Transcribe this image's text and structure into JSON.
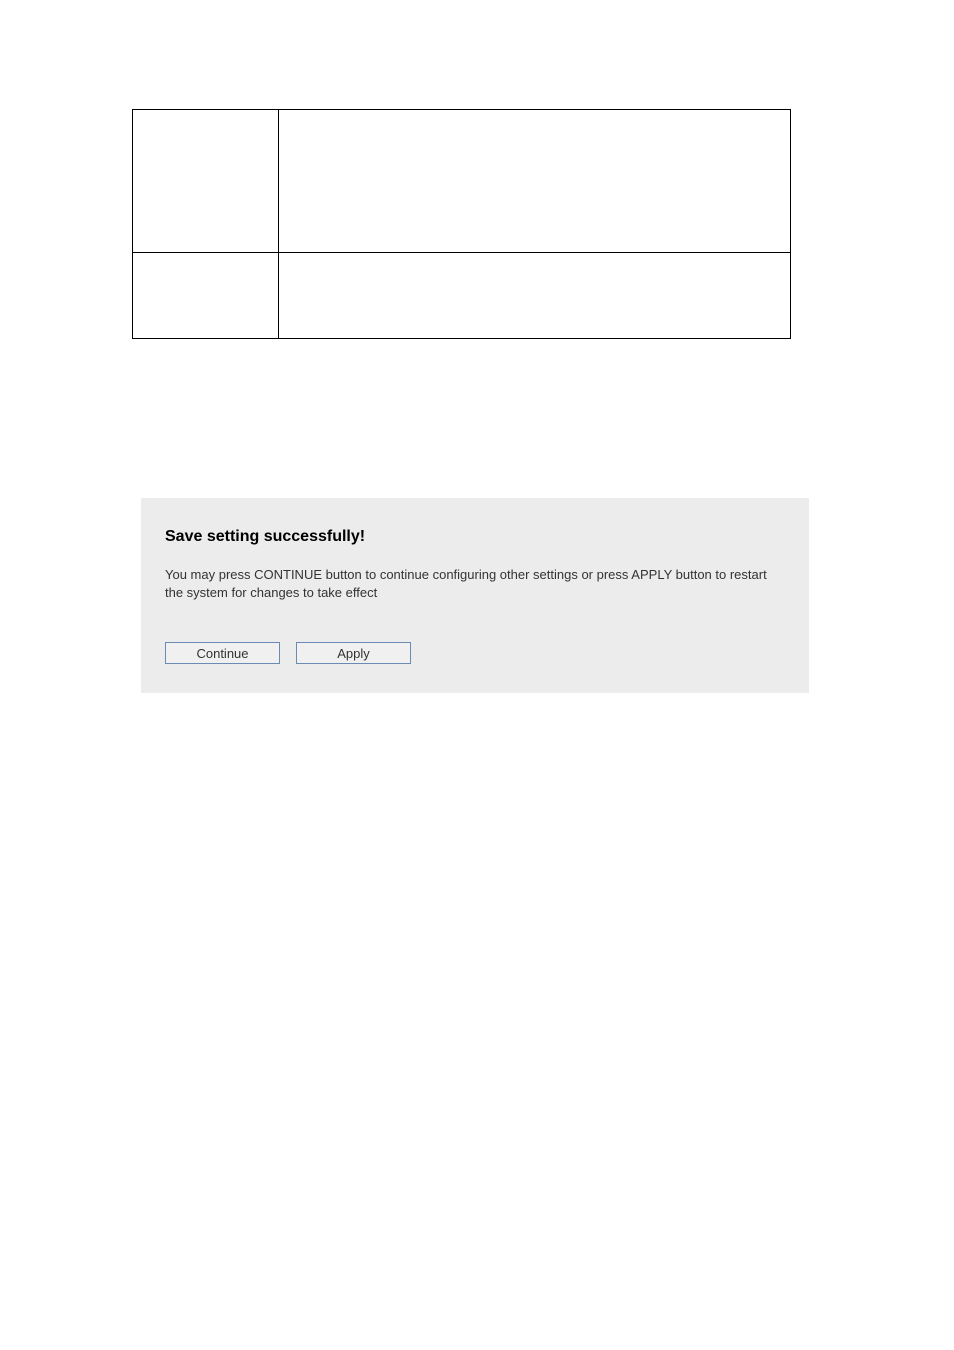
{
  "panel": {
    "title": "Save setting successfully!",
    "message": "You may press CONTINUE button to continue configuring other settings or press APPLY button to restart the system for changes to take effect",
    "continue_label": "Continue",
    "apply_label": "Apply"
  }
}
